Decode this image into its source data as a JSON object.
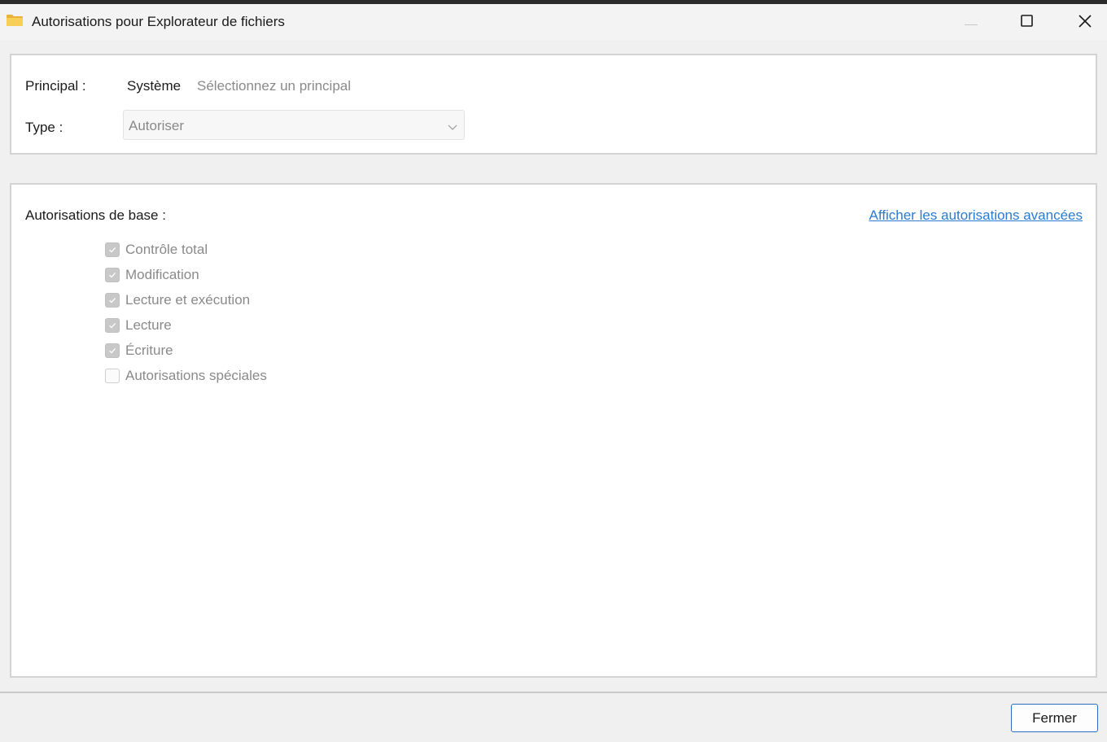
{
  "window": {
    "title": "Autorisations pour Explorateur de fichiers",
    "icon": "folder-icon",
    "controls": [
      "minimize-icon",
      "maximize-icon",
      "close-icon"
    ]
  },
  "principal_section": {
    "principal_label": "Principal :",
    "principal_value": "Système",
    "select_principal_link": "Sélectionnez un principal",
    "type_label": "Type :",
    "type_value": "Autoriser"
  },
  "permissions": {
    "heading": "Autorisations de base :",
    "advanced_link": "Afficher les autorisations avancées",
    "items": [
      {
        "label": "Contrôle total",
        "checked": true
      },
      {
        "label": "Modification",
        "checked": true
      },
      {
        "label": "Lecture et exécution",
        "checked": true
      },
      {
        "label": "Lecture",
        "checked": true
      },
      {
        "label": "Écriture",
        "checked": true
      },
      {
        "label": "Autorisations spéciales",
        "checked": false
      }
    ]
  },
  "footer": {
    "close_label": "Fermer"
  },
  "colors": {
    "link": "#2a7bd0",
    "disabled_text": "#8a8a8a",
    "folder": "#f5c542"
  }
}
